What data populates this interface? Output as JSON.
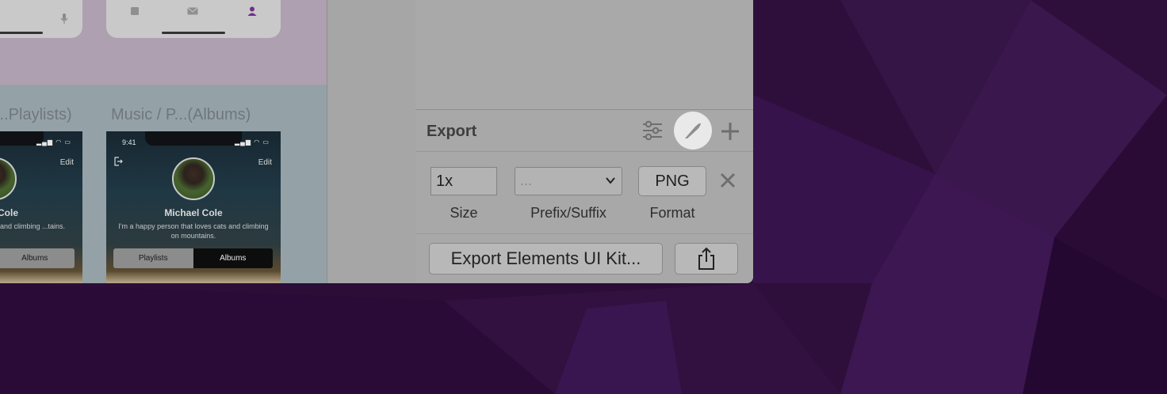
{
  "artboards": [
    {
      "title": "...Playlists)",
      "time": "",
      "edit_label": "Edit",
      "name": "l Cole",
      "bio": "...loves cats and climbing ...tains.",
      "segment_left": "",
      "segment_right": "Albums"
    },
    {
      "title": "Music / P...(Albums)",
      "time": "9:41",
      "edit_label": "Edit",
      "name": "Michael Cole",
      "bio": "I'm a happy person that loves cats and climbing on mountains.",
      "segment_left": "Playlists",
      "segment_right": "Albums"
    }
  ],
  "export": {
    "title": "Export",
    "size_value": "1x",
    "size_label": "Size",
    "prefix_value": "...",
    "prefix_label": "Prefix/Suffix",
    "format_value": "PNG",
    "format_label": "Format",
    "export_button_label": "Export Elements UI Kit..."
  },
  "colors": {
    "desktop": "#2b0d38",
    "panel": "#a8a8a8",
    "highlight": "#e9e9e9"
  }
}
